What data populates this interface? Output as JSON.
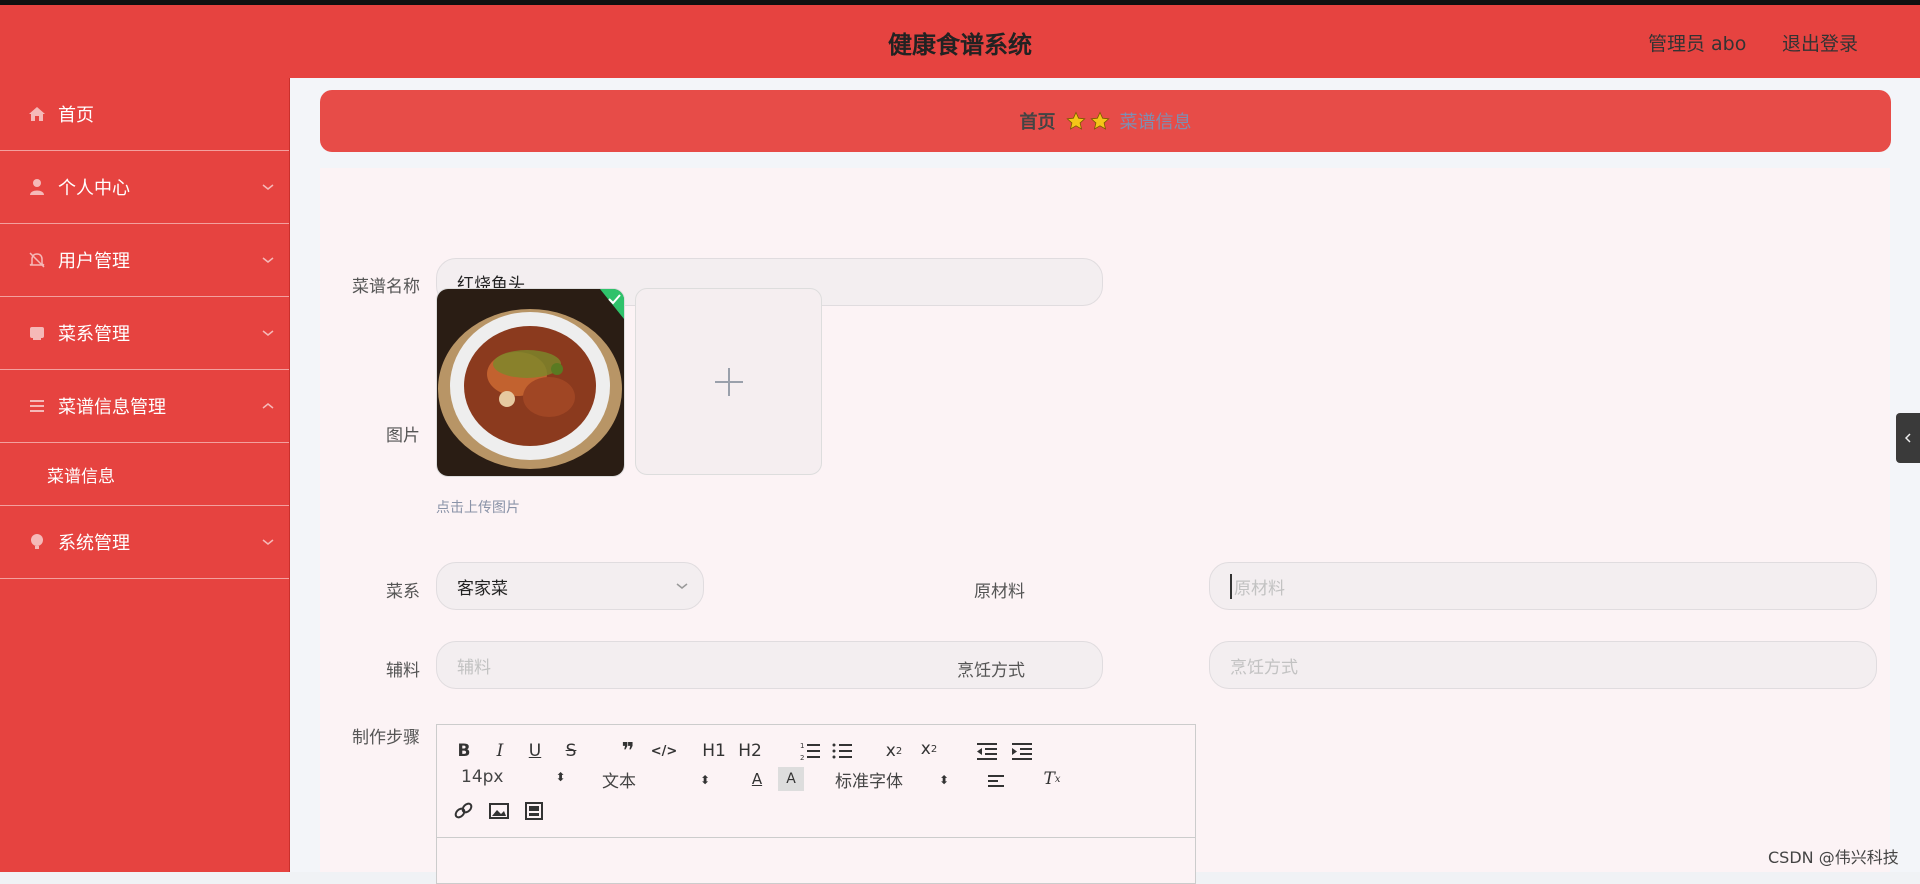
{
  "header": {
    "title": "健康食谱系统",
    "admin_label": "管理员 abo",
    "logout_label": "退出登录"
  },
  "sidebar": {
    "items": [
      {
        "label": "首页",
        "icon": "home-icon"
      },
      {
        "label": "个人中心",
        "icon": "user-icon"
      },
      {
        "label": "用户管理",
        "icon": "bell-off-icon"
      },
      {
        "label": "菜系管理",
        "icon": "book-icon"
      },
      {
        "label": "菜谱信息管理",
        "icon": "list-icon"
      },
      {
        "label": "系统管理",
        "icon": "lightbulb-icon"
      }
    ],
    "submenu": {
      "label": "菜谱信息"
    }
  },
  "breadcrumb": {
    "home": "首页",
    "current": "菜谱信息"
  },
  "form": {
    "name_label": "菜谱名称",
    "name_value": "红烧鱼头",
    "image_label": "图片",
    "upload_tip": "点击上传图片",
    "cuisine_label": "菜系",
    "cuisine_value": "客家菜",
    "ingredients_label": "原材料",
    "ingredients_placeholder": "原材料",
    "accessories_label": "辅料",
    "accessories_placeholder": "辅料",
    "cooking_label": "烹饪方式",
    "cooking_placeholder": "烹饪方式",
    "steps_label": "制作步骤"
  },
  "editor": {
    "font_size": "14px",
    "text_type": "文本",
    "font_family": "标准字体",
    "h1": "H1",
    "h2": "H2"
  },
  "colors": {
    "brand": "#e64340",
    "breadcrumb_bg": "#e74c48",
    "star": "#f5c518"
  },
  "watermark": "CSDN @伟兴科技"
}
